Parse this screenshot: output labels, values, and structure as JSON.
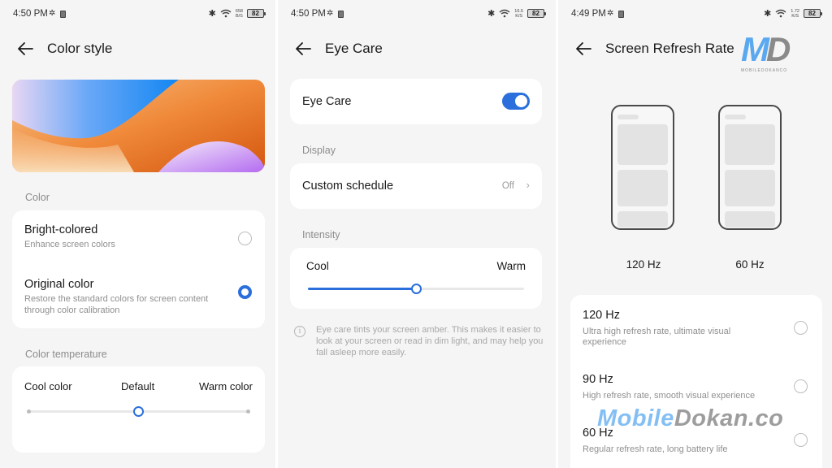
{
  "panels": [
    {
      "status": {
        "time": "4:50 PM",
        "speed_top": "658",
        "speed_unit": "B/S",
        "battery": "82"
      },
      "header": {
        "title": "Color style"
      },
      "color_section": {
        "label": "Color",
        "options": [
          {
            "title": "Bright-colored",
            "subtitle": "Enhance screen colors",
            "selected": false
          },
          {
            "title": "Original color",
            "subtitle": "Restore the standard colors for screen content through color calibration",
            "selected": true
          }
        ]
      },
      "temperature_section": {
        "label": "Color temperature",
        "left_label": "Cool color",
        "center_label": "Default",
        "right_label": "Warm color",
        "value": 0.5
      }
    },
    {
      "status": {
        "time": "4:50 PM",
        "speed_top": "16.5",
        "speed_unit": "K/S",
        "battery": "82"
      },
      "header": {
        "title": "Eye Care"
      },
      "eye_care_toggle": {
        "label": "Eye Care",
        "on": true
      },
      "display_section": {
        "label": "Display",
        "custom_schedule": {
          "label": "Custom schedule",
          "value": "Off"
        }
      },
      "intensity_section": {
        "label": "Intensity",
        "left_label": "Cool",
        "right_label": "Warm",
        "value": 0.5
      },
      "info": "Eye care tints your screen amber. This makes it easier to look at your screen or read in dim light, and may help you fall asleep more easily."
    },
    {
      "status": {
        "time": "4:49 PM",
        "speed_top": "1.72",
        "speed_unit": "K/S",
        "battery": "82"
      },
      "header": {
        "title": "Screen Refresh Rate"
      },
      "previews": [
        {
          "label": "120 Hz"
        },
        {
          "label": "60 Hz"
        }
      ],
      "options": [
        {
          "title": "120 Hz",
          "subtitle": "Ultra high refresh rate, ultimate visual experience",
          "selected": false
        },
        {
          "title": "90 Hz",
          "subtitle": "High refresh rate, smooth visual experience",
          "selected": false
        },
        {
          "title": "60 Hz",
          "subtitle": "Regular refresh rate, long battery life",
          "selected": false
        }
      ],
      "logo": {
        "m": "M",
        "d": "D",
        "small": "MOBILEDOKANCO"
      },
      "watermark": {
        "part1": "Mobile",
        "part2": "Dokan.co"
      }
    }
  ],
  "colors": {
    "accent": "#2a6fdb",
    "background": "#f5f5f5",
    "card": "#ffffff"
  },
  "icons": {
    "back": "arrow-left-icon",
    "settings": "gear-icon",
    "sim": "sim-card-icon",
    "bluetooth": "bluetooth-icon",
    "wifi": "wifi-icon",
    "battery": "battery-icon",
    "chevron": "chevron-right-icon",
    "info": "info-icon"
  }
}
